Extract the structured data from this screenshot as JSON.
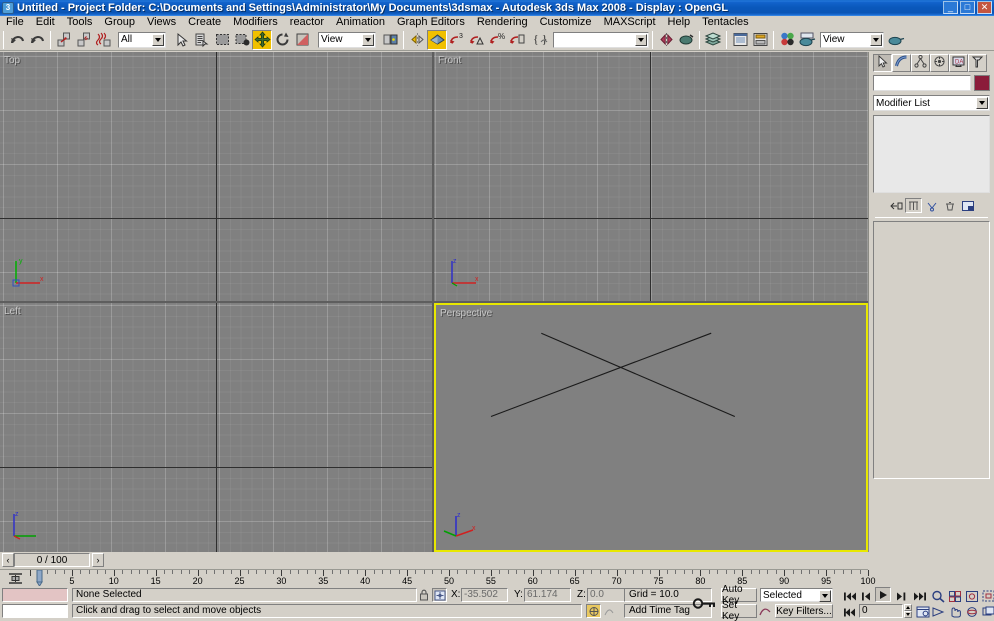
{
  "window": {
    "title": "Untitled    - Project Folder: C:\\Documents and Settings\\Administrator\\My Documents\\3dsmax     - Autodesk 3ds Max 2008     - Display : OpenGL",
    "app_icon": "max-logo-icon",
    "minimize_label": "_",
    "restore_label": "□",
    "close_label": "✕"
  },
  "menu": {
    "items": [
      {
        "label": "File"
      },
      {
        "label": "Edit"
      },
      {
        "label": "Tools"
      },
      {
        "label": "Group"
      },
      {
        "label": "Views"
      },
      {
        "label": "Create"
      },
      {
        "label": "Modifiers"
      },
      {
        "label": "reactor"
      },
      {
        "label": "Animation"
      },
      {
        "label": "Graph Editors"
      },
      {
        "label": "Rendering"
      },
      {
        "label": "Customize"
      },
      {
        "label": "MAXScript"
      },
      {
        "label": "Help"
      },
      {
        "label": "Tentacles"
      }
    ]
  },
  "toolbar": {
    "undo_tip": "Undo",
    "redo_tip": "Redo",
    "select_link_tip": "Select and Link",
    "unlink_tip": "Unlink Selection",
    "bind_space_warp_tip": "Bind to Space Warp",
    "selection_filter_value": "All",
    "select_object_tip": "Select Object",
    "select_by_name_tip": "Select by Name",
    "select_region_tip": "Rectangular Selection Region",
    "window_crossing_tip": "Window / Crossing",
    "select_move_tip": "Select and Move",
    "select_rotate_tip": "Select and Rotate",
    "select_scale_tip": "Select and Uniform Scale",
    "ref_coord_value": "View",
    "use_center_tip": "Use Pivot Point Center",
    "mirror_tip": "Mirror",
    "snap_toggle_tip": "Snaps Toggle",
    "snap_value": "3",
    "angle_snap_tip": "Angle Snap Toggle",
    "percent_snap_tip": "Percent Snap Toggle",
    "spinner_snap_tip": "Spinner Snap Toggle",
    "named_sets_tip": "Named Selection Sets",
    "named_sets_value": "",
    "mirror2_tip": "Mirror",
    "align_tip": "Align",
    "layer_manager_tip": "Layer Manager",
    "curve_editor_tip": "Curve Editor",
    "schematic_view_tip": "Schematic View",
    "material_editor_tip": "Material Editor",
    "render_setup_tip": "Render Scene Dialog",
    "render_preset_value": "View",
    "quick_render_tip": "Quick Render"
  },
  "viewports": [
    {
      "name": "Top",
      "label": "Top",
      "active": false,
      "tripod": "z-up-xy"
    },
    {
      "name": "Front",
      "label": "Front",
      "active": false,
      "tripod": "z-up-x-right"
    },
    {
      "name": "Left",
      "label": "Left",
      "active": false,
      "tripod": "z-up-x-right"
    },
    {
      "name": "Perspective",
      "label": "Perspective",
      "active": true,
      "tripod": "persp-xyz"
    }
  ],
  "scene": {
    "objects": [
      {
        "type": "line",
        "x1": 0.245,
        "y1": 0.115,
        "x2": 0.695,
        "y2": 0.455
      },
      {
        "type": "line",
        "x1": 0.64,
        "y1": 0.115,
        "x2": 0.128,
        "y2": 0.455
      }
    ],
    "line_color": "#1a1a1a"
  },
  "command_panel": {
    "tabs": [
      {
        "name": "create",
        "icon": "arrow-cursor-icon",
        "selected": true
      },
      {
        "name": "modify",
        "icon": "bent-pipe-icon",
        "selected": false
      },
      {
        "name": "hierarchy",
        "icon": "hierarchy-tree-icon",
        "selected": false
      },
      {
        "name": "motion",
        "icon": "motion-wheel-icon",
        "selected": false
      },
      {
        "name": "display",
        "icon": "display-monitor-icon",
        "selected": false
      },
      {
        "name": "utilities",
        "icon": "hammer-icon",
        "selected": false
      }
    ],
    "object_name_value": "",
    "object_name_placeholder": "",
    "object_color": "#8b1c3a",
    "modifier_list_value": "Modifier List",
    "stack_entries": [],
    "stack_buttons": [
      {
        "name": "pin-stack",
        "icon": "pin-icon"
      },
      {
        "name": "show-end-result",
        "icon": "show-end-result-icon"
      },
      {
        "name": "make-unique",
        "icon": "make-unique-icon"
      },
      {
        "name": "remove-modifier",
        "icon": "trash-icon"
      },
      {
        "name": "configure-sets",
        "icon": "configure-sets-icon"
      }
    ]
  },
  "time_slider": {
    "frame_display": "0 / 100",
    "prev_label": "‹",
    "next_label": "›"
  },
  "track_bar": {
    "range_start": 0,
    "range_end": 100,
    "major_ticks": [
      0,
      5,
      10,
      15,
      20,
      25,
      30,
      35,
      40,
      45,
      50,
      55,
      60,
      65,
      70,
      75,
      80,
      85,
      90,
      95,
      100
    ],
    "current_frame": 0
  },
  "status_bar": {
    "selection_text": "None Selected",
    "prompt_text": "Click and drag to select and move objects",
    "lock_tip": "Selection Lock Toggle",
    "absolute_mode_tip": "Absolute Mode Transform Type-In",
    "x_label": "X:",
    "x_value": "-35.502",
    "y_label": "Y:",
    "y_value": "61.174",
    "z_label": "Z:",
    "z_value": "0.0",
    "grid_text": "Grid = 10.0",
    "add_time_tag_text": "Add Time Tag",
    "adaptive_degradation_tip": "Adaptive Degradation Toggle",
    "key_mode_tip": "Key Mode Toggle"
  },
  "animation": {
    "auto_key_label": "Auto Key",
    "set_key_label": "Set Key",
    "key_filters_label": "Key Filters...",
    "selection_set_value": "Selected",
    "frame_value": "0",
    "goto_start_tip": "Go to Start",
    "prev_frame_tip": "Previous Frame",
    "play_tip": "Play Animation",
    "next_frame_tip": "Next Frame",
    "goto_end_tip": "Go to End",
    "time_config_tip": "Time Configuration"
  },
  "viewport_nav": {
    "buttons": [
      {
        "name": "zoom",
        "icon": "magnifier-icon"
      },
      {
        "name": "zoom-all",
        "icon": "zoom-all-icon"
      },
      {
        "name": "zoom-extents",
        "icon": "zoom-extents-icon"
      },
      {
        "name": "zoom-region",
        "icon": "zoom-region-icon"
      },
      {
        "name": "field-of-view",
        "icon": "fov-icon"
      },
      {
        "name": "pan",
        "icon": "hand-icon"
      },
      {
        "name": "arc-rotate",
        "icon": "arc-rotate-icon"
      },
      {
        "name": "min-max-toggle",
        "icon": "maximize-viewport-icon"
      }
    ]
  },
  "colors": {
    "accent_yellow": "#e8e800",
    "viewport_bg": "#808080",
    "chrome": "#d4d0c8",
    "title_blue": "#0a58bb"
  }
}
